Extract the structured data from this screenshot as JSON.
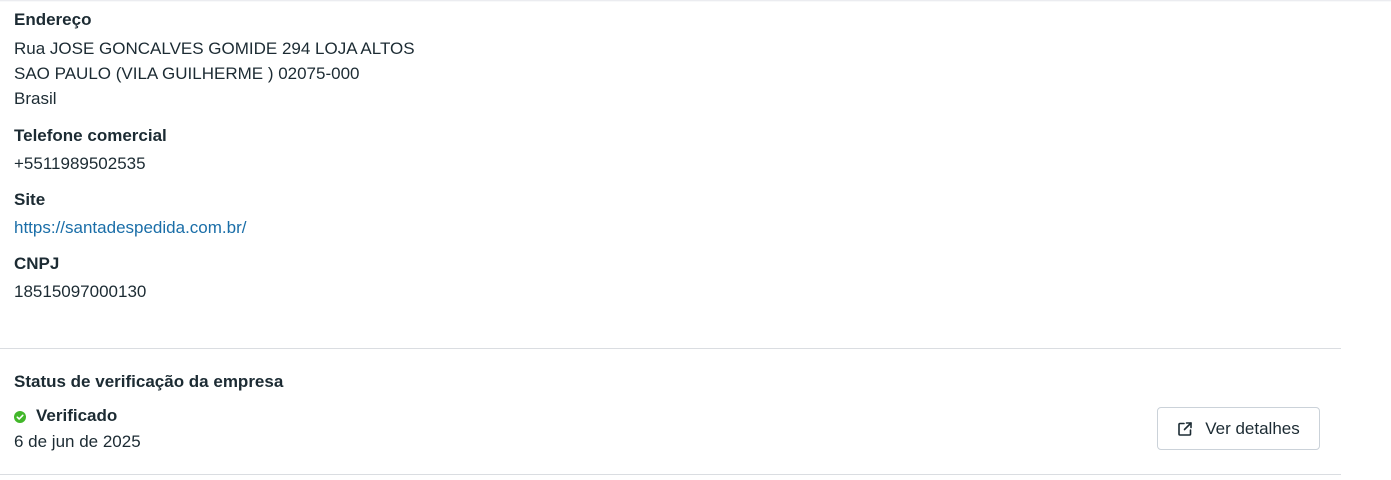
{
  "address": {
    "label": "Endereço",
    "line1": "Rua JOSE GONCALVES GOMIDE 294 LOJA ALTOS",
    "line2": "SAO PAULO (VILA GUILHERME ) 02075-000",
    "line3": "Brasil"
  },
  "phone": {
    "label": "Telefone comercial",
    "value": "+5511989502535"
  },
  "website": {
    "label": "Site",
    "value": "https://santadespedida.com.br/"
  },
  "cnpj": {
    "label": "CNPJ",
    "value": "18515097000130"
  },
  "verification": {
    "title": "Status de verificação da empresa",
    "status": "Verificado",
    "status_icon": "check-circle-icon",
    "status_color": "#42b72a",
    "date": "6 de jun de 2025",
    "details_button_label": "Ver detalhes",
    "details_button_icon": "external-link-icon"
  },
  "colors": {
    "text": "#1c2b33",
    "link": "#1a6ea8",
    "divider": "#dadde1"
  }
}
